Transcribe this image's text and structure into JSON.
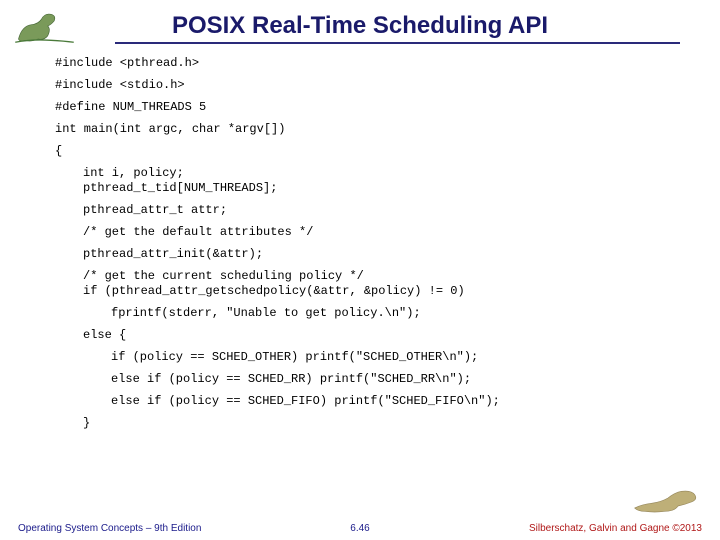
{
  "title": "POSIX Real-Time Scheduling API",
  "code": {
    "inc1": "#include <pthread.h>",
    "inc2": "#include <stdio.h>",
    "def": "#define NUM_THREADS 5",
    "main": "int main(int argc, char *argv[])",
    "brace": "{",
    "l1a": "int i, policy;",
    "l1b": "pthread_t_tid[NUM_THREADS];",
    "l2": "pthread_attr_t attr;",
    "l3": "/* get the default attributes */",
    "l4": "pthread_attr_init(&attr);",
    "l5a": "/* get the current scheduling policy */",
    "l5b": "if (pthread_attr_getschedpolicy(&attr, &policy) != 0)",
    "l6": "fprintf(stderr, \"Unable to get policy.\\n\");",
    "l7": "else {",
    "l8": "if (policy == SCHED_OTHER) printf(\"SCHED_OTHER\\n\");",
    "l9": "else if (policy == SCHED_RR) printf(\"SCHED_RR\\n\");",
    "l10": "else if (policy == SCHED_FIFO) printf(\"SCHED_FIFO\\n\");",
    "l11": "}"
  },
  "footer": {
    "left": "Operating System Concepts – 9th Edition",
    "center": "6.46",
    "right": "Silberschatz, Galvin and Gagne ©2013"
  },
  "icons": {
    "dino_left": "dinosaur-left",
    "dino_right": "dinosaur-right"
  }
}
